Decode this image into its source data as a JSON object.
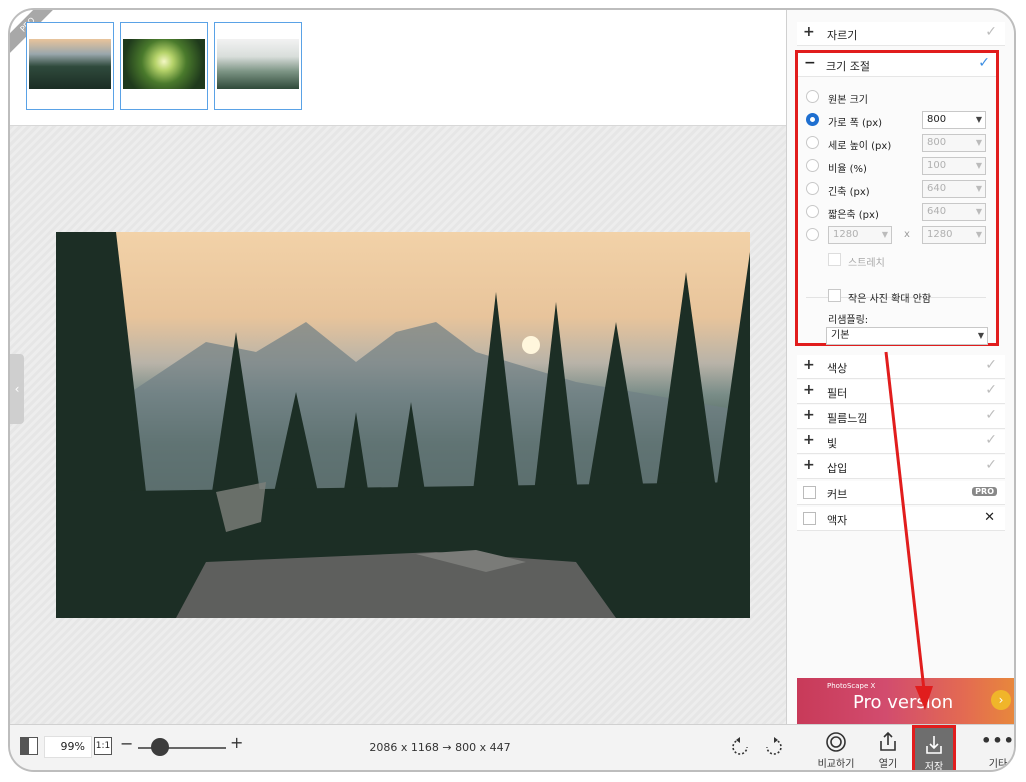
{
  "filmstrip": {
    "pro_ribbon": "PRO",
    "thumbs": [
      "thumb-lake-sunset",
      "thumb-forest-canopy",
      "thumb-misty-forest"
    ]
  },
  "canvas": {
    "side_toggle": "‹"
  },
  "bottom": {
    "zoom_value": "99%",
    "one_to_one": "1:1",
    "zoom_minus": "−",
    "zoom_plus": "+",
    "dimensions": "2086 x 1168 → 800 x 447",
    "zoom_level": 0.25,
    "buttons": {
      "compare": "비교하기",
      "open": "열기",
      "save": "저장",
      "more": "기타"
    }
  },
  "panel": {
    "crop": {
      "label": "자르기",
      "toggle": "+",
      "check": "✓"
    },
    "resize": {
      "label": "크기 조절",
      "toggle": "−",
      "check": "✓",
      "options": [
        {
          "label": "원본 크기",
          "selected": false,
          "value": null
        },
        {
          "label": "가로 폭 (px)",
          "selected": true,
          "value": "800"
        },
        {
          "label": "세로 높이 (px)",
          "selected": false,
          "value": "800"
        },
        {
          "label": "비율 (%)",
          "selected": false,
          "value": "100"
        },
        {
          "label": "긴축 (px)",
          "selected": false,
          "value": "640"
        },
        {
          "label": "짧은축 (px)",
          "selected": false,
          "value": "640"
        }
      ],
      "custom_w": "1280",
      "custom_x": "x",
      "custom_h": "1280",
      "stretch_label": "스트레치",
      "no_upscale_label": "작은 사진 확대 안함",
      "resampling_label": "리샘플링:",
      "resampling_value": "기본"
    },
    "sections": [
      {
        "label": "색상",
        "toggle": "+",
        "check": "✓"
      },
      {
        "label": "필터",
        "toggle": "+",
        "check": "✓"
      },
      {
        "label": "필름느낌",
        "toggle": "+",
        "check": "✓"
      },
      {
        "label": "빛",
        "toggle": "+",
        "check": "✓"
      },
      {
        "label": "삽입",
        "toggle": "+",
        "check": "✓"
      }
    ],
    "curves": {
      "label": "커브",
      "badge": "PRO"
    },
    "frame": {
      "label": "액자",
      "close": "✕"
    },
    "ad": {
      "line1": "PhotoScape X",
      "line2": "Pro version",
      "go": "›"
    }
  },
  "colors": {
    "accent_blue": "#1e6fd0",
    "highlight_red": "#e11d1d"
  }
}
